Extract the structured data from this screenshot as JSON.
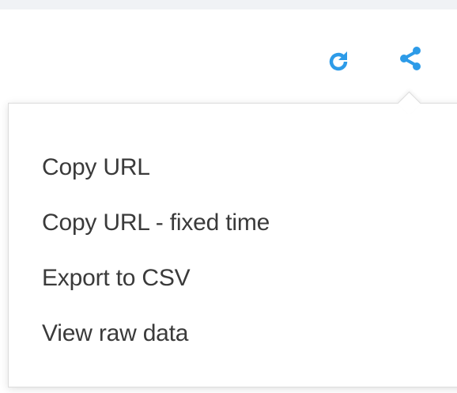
{
  "toolbar": {
    "refresh_icon": "refresh-icon",
    "share_icon": "share-icon",
    "accent_color": "#2d9be8"
  },
  "share_menu": {
    "items": [
      {
        "label": "Copy URL"
      },
      {
        "label": "Copy URL - fixed time"
      },
      {
        "label": "Export to CSV"
      },
      {
        "label": "View raw data"
      }
    ]
  }
}
